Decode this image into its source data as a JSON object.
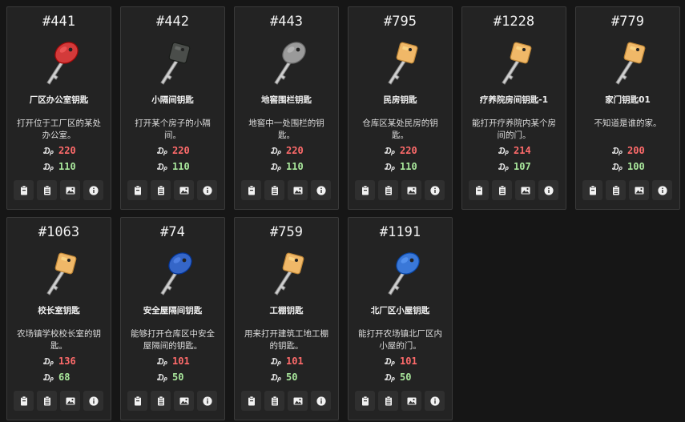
{
  "currency_symbol": "₯",
  "cards": [
    {
      "id": "#441",
      "name": "厂区办公室钥匙",
      "desc": "打开位于工厂区的某处办公室。",
      "sell": "220",
      "buy": "110",
      "key_color": "#d33a3a",
      "key_style": "round"
    },
    {
      "id": "#442",
      "name": "小隔间钥匙",
      "desc": "打开某个房子的小隔间。",
      "sell": "220",
      "buy": "110",
      "key_color": "#4a4d4a",
      "key_style": "square"
    },
    {
      "id": "#443",
      "name": "地窖围栏钥匙",
      "desc": "地窖中一处围栏的钥匙。",
      "sell": "220",
      "buy": "110",
      "key_color": "#9a9a9a",
      "key_style": "round"
    },
    {
      "id": "#795",
      "name": "民房钥匙",
      "desc": "仓库区某处民房的钥匙。",
      "sell": "220",
      "buy": "110",
      "key_color": "#f0b868",
      "key_style": "square"
    },
    {
      "id": "#1228",
      "name": "疗养院房间钥匙-1",
      "desc": "能打开疗养院内某个房间的门。",
      "sell": "214",
      "buy": "107",
      "key_color": "#f0b868",
      "key_style": "square"
    },
    {
      "id": "#779",
      "name": "家门钥匙01",
      "desc": "不知道是谁的家。",
      "sell": "200",
      "buy": "100",
      "key_color": "#f0b868",
      "key_style": "square"
    },
    {
      "id": "#1063",
      "name": "校长室钥匙",
      "desc": "农场镇学校校长室的钥匙。",
      "sell": "136",
      "buy": "68",
      "key_color": "#f0b868",
      "key_style": "square"
    },
    {
      "id": "#74",
      "name": "安全屋隔间钥匙",
      "desc": "能够打开仓库区中安全屋隔间的钥匙。",
      "sell": "101",
      "buy": "50",
      "key_color": "#3566c8",
      "key_style": "round"
    },
    {
      "id": "#759",
      "name": "工棚钥匙",
      "desc": "用来打开建筑工地工棚的钥匙。",
      "sell": "101",
      "buy": "50",
      "key_color": "#f0b868",
      "key_style": "square"
    },
    {
      "id": "#1191",
      "name": "北厂区小屋钥匙",
      "desc": "能打开农场镇北厂区内小屋的门。",
      "sell": "101",
      "buy": "50",
      "key_color": "#3a78d8",
      "key_style": "round"
    }
  ],
  "actions": [
    {
      "icon": "clipboard-icon"
    },
    {
      "icon": "list-clipboard-icon"
    },
    {
      "icon": "image-icon"
    },
    {
      "icon": "info-icon"
    }
  ]
}
